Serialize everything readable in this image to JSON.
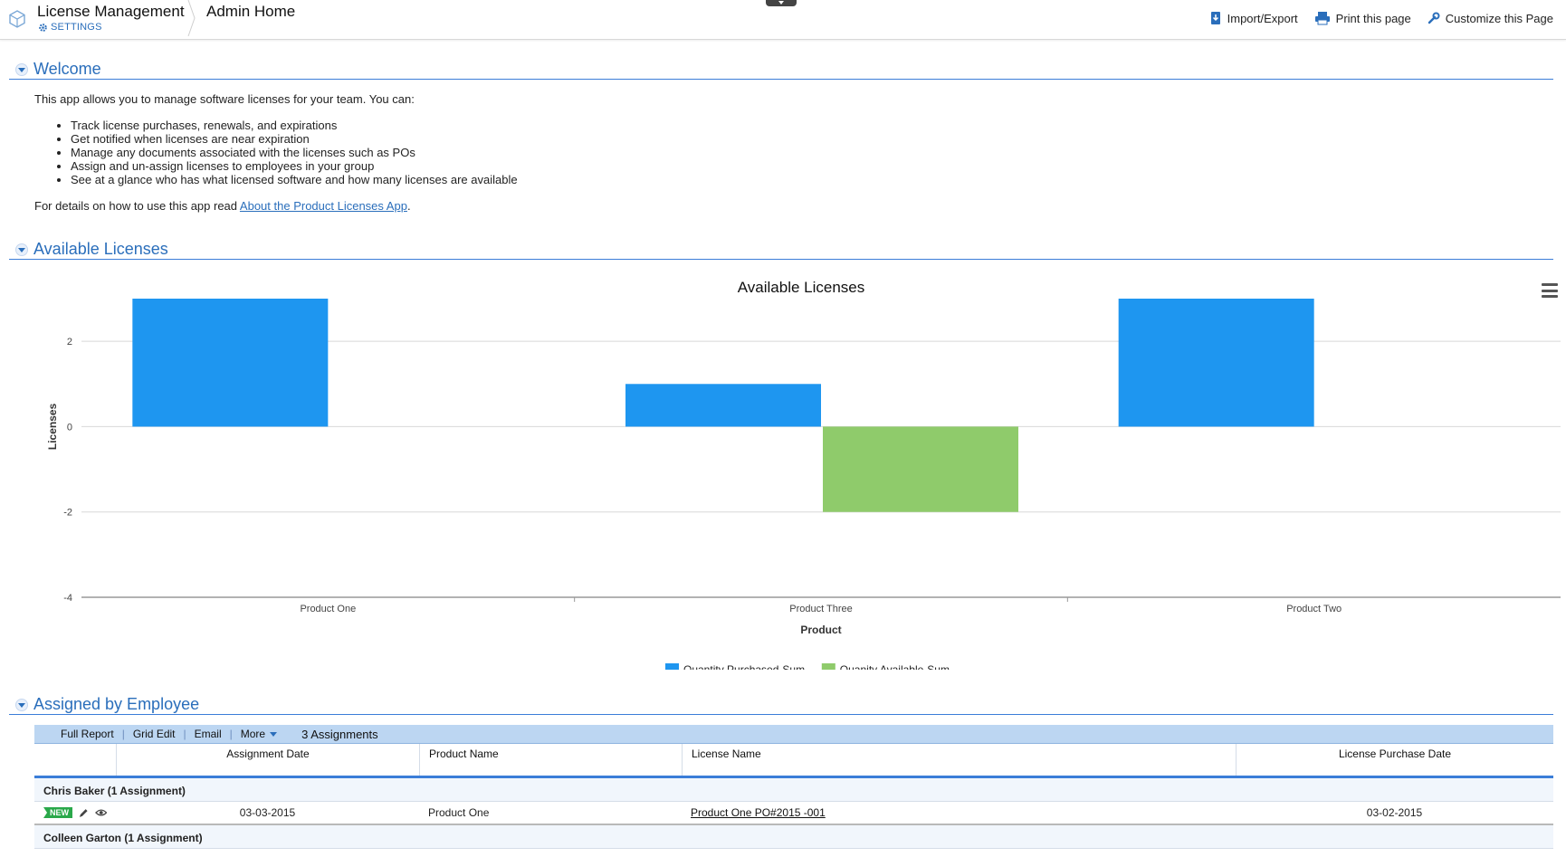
{
  "header": {
    "app_title": "License Management",
    "settings_label": "SETTINGS",
    "page_title": "Admin Home",
    "actions": [
      {
        "label": "Import/Export",
        "icon": "import-export-icon"
      },
      {
        "label": "Print this page",
        "icon": "printer-icon"
      },
      {
        "label": "Customize this Page",
        "icon": "wrench-icon"
      }
    ]
  },
  "colors": {
    "accent": "#2a6ebb",
    "bar_purchased": "#1e96f0",
    "bar_available": "#8fcb6b"
  },
  "welcome": {
    "section_title": "Welcome",
    "intro": "This app allows you to manage software licenses for your team.  You can:",
    "bullets": [
      "Track license purchases, renewals, and expirations",
      "Get notified when licenses are near expiration",
      "Manage any documents associated with the licenses such as POs",
      "Assign and un-assign licenses to employees in your group",
      "See at a glance who has what licensed software and how many licenses are available"
    ],
    "details_prefix": "For details on how to use this app read ",
    "details_link": "About the Product Licenses App",
    "details_suffix": "."
  },
  "available_section": {
    "section_title": "Available Licenses"
  },
  "chart_data": {
    "type": "bar",
    "title": "Available Licenses",
    "xlabel": "Product",
    "ylabel": "Licenses",
    "categories": [
      "Product One",
      "Product Three",
      "Product Two"
    ],
    "series": [
      {
        "name": "Quantity Purchased-Sum",
        "values": [
          3,
          1,
          3
        ]
      },
      {
        "name": "Quanity Available-Sum",
        "values": [
          0,
          -2,
          0
        ]
      }
    ],
    "ylim": [
      -4,
      3
    ],
    "yticks": [
      2,
      0,
      -2,
      -4
    ],
    "grid": true,
    "legend": "bottom-center"
  },
  "employee_section": {
    "section_title": "Assigned by Employee",
    "toolbar": {
      "items": [
        "Full Report",
        "Grid Edit",
        "Email",
        "More"
      ],
      "count_label": "3 Assignments"
    },
    "columns": [
      "Assignment Date",
      "Product Name",
      "License Name",
      "License Purchase Date"
    ],
    "groups": [
      {
        "label": "Chris Baker  (1 Assignment)",
        "rows": [
          {
            "badge": "NEW",
            "assignment_date": "03-03-2015",
            "product_name": "Product One",
            "license_name": "Product One PO#2015 -001",
            "purchase_date": "03-02-2015"
          }
        ]
      },
      {
        "label": "Colleen Garton  (1 Assignment)",
        "rows": []
      }
    ]
  }
}
